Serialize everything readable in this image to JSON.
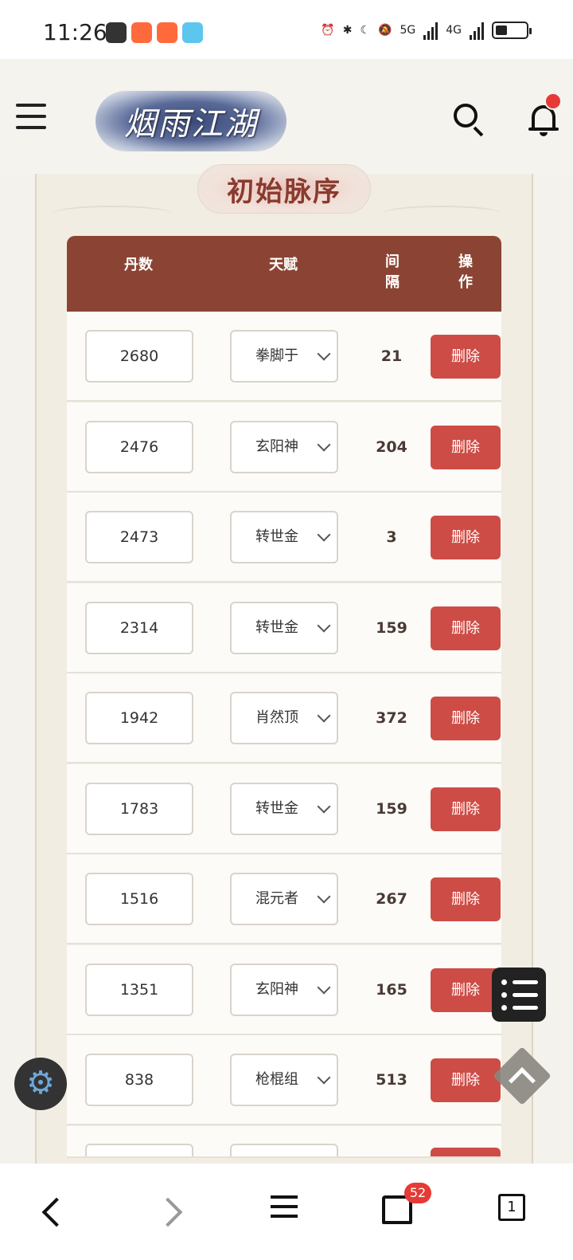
{
  "status_bar": {
    "time": "11:26",
    "network_5g": "5G",
    "network_4g": "4G"
  },
  "header": {
    "logo_text": "烟雨江湖"
  },
  "section": {
    "title": "初始脉序"
  },
  "table": {
    "headers": {
      "dan": "丹数",
      "talent": "天赋",
      "interval": "间隔",
      "action": "操作"
    },
    "rows": [
      {
        "dan": "2680",
        "talent": "拳脚于",
        "interval": "21",
        "action": "删除"
      },
      {
        "dan": "2476",
        "talent": "玄阳神",
        "interval": "204",
        "action": "删除"
      },
      {
        "dan": "2473",
        "talent": "转世金",
        "interval": "3",
        "action": "删除"
      },
      {
        "dan": "2314",
        "talent": "转世金",
        "interval": "159",
        "action": "删除"
      },
      {
        "dan": "1942",
        "talent": "肖然顶",
        "interval": "372",
        "action": "删除"
      },
      {
        "dan": "1783",
        "talent": "转世金",
        "interval": "159",
        "action": "删除"
      },
      {
        "dan": "1516",
        "talent": "混元者",
        "interval": "267",
        "action": "删除"
      },
      {
        "dan": "1351",
        "talent": "玄阳神",
        "interval": "165",
        "action": "删除"
      },
      {
        "dan": "838",
        "talent": "枪棍组",
        "interval": "513",
        "action": "删除"
      }
    ]
  },
  "bottom_nav": {
    "tabs_badge": "52",
    "tab_count": "1"
  },
  "colors": {
    "header_brown": "#8b4433",
    "delete_red": "#cd4c46",
    "title_text": "#8b3a2e"
  }
}
